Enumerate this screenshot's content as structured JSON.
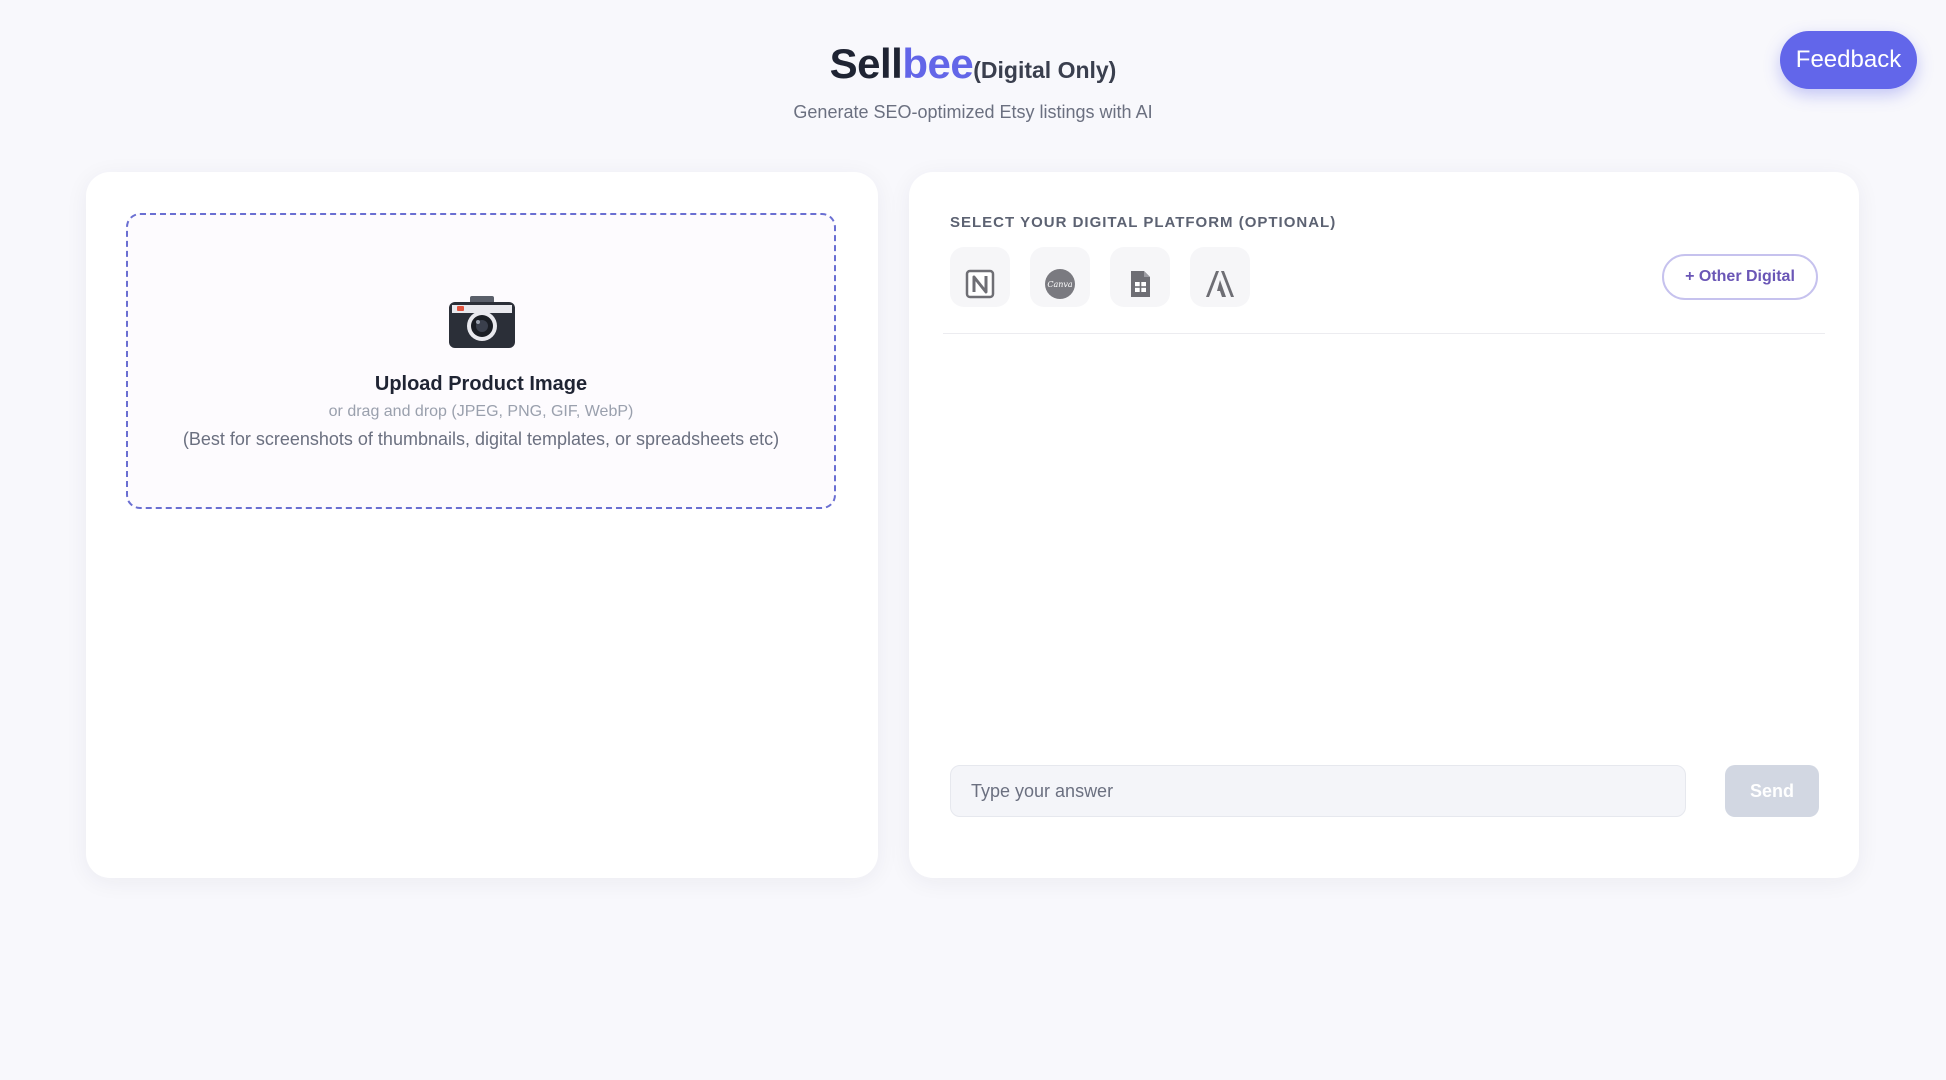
{
  "header": {
    "brand_part1": "Sell",
    "brand_part2": "bee",
    "brand_suffix": "(Digital Only)",
    "subtitle": "Generate SEO-optimized Etsy listings with AI",
    "feedback_label": "Feedback"
  },
  "upload": {
    "icon": "camera-icon",
    "title": "Upload Product Image",
    "hint": "or drag and drop (JPEG, PNG, GIF, WebP)",
    "note": "(Best for screenshots of thumbnails, digital templates, or spreadsheets etc)"
  },
  "platforms": {
    "label": "SELECT YOUR DIGITAL PLATFORM (OPTIONAL)",
    "items": [
      {
        "icon": "notion-icon"
      },
      {
        "icon": "canva-icon",
        "text": "Canva"
      },
      {
        "icon": "google-sheets-icon"
      },
      {
        "icon": "adobe-icon"
      }
    ],
    "other_label": "+ Other Digital"
  },
  "chat": {
    "input_placeholder": "Type your answer",
    "send_label": "Send"
  },
  "colors": {
    "accent": "#6366e8",
    "feedback_bg": "#6266ea",
    "dashed_border": "#6a6fd2",
    "send_disabled": "#d2d7e2"
  }
}
